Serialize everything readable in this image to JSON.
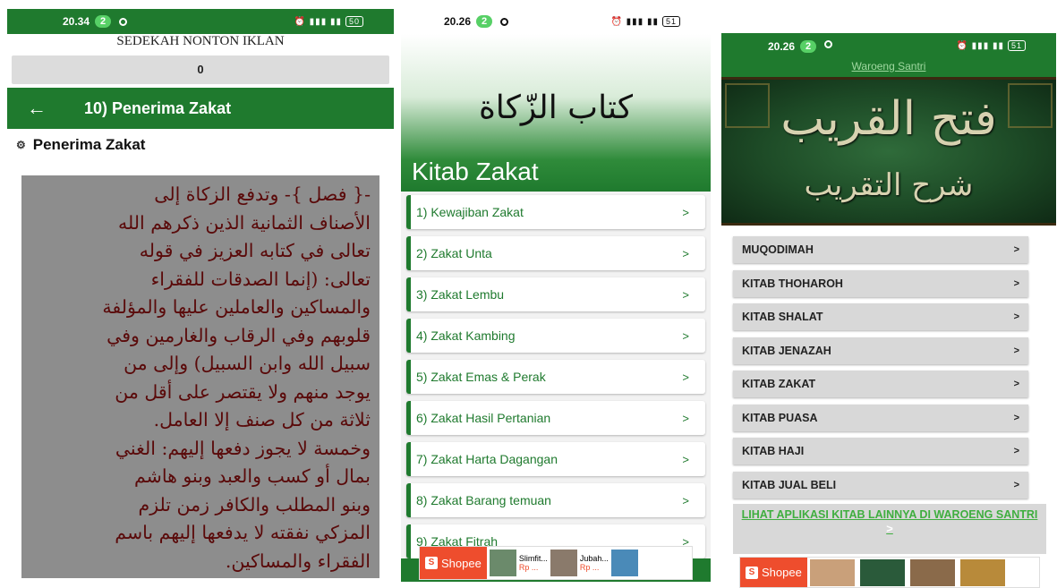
{
  "panel1": {
    "status": {
      "time": "20.34",
      "badge": "2",
      "battery": "50"
    },
    "sedekah_title": "SEDEKAH NONTON IKLAN",
    "counter_value": "0",
    "toolbar_title": "10) Penerima Zakat",
    "subheading": "Penerima Zakat",
    "arabic_lines": [
      "-{ فصل }- وتدفع الزكاة إلى",
      "الأصناف الثمانية الذين ذكرهم الله",
      "تعالى في كتابه العزيز في قوله",
      "تعالى: (إنما الصدقات للفقراء",
      "والمساكين والعاملين عليها والمؤلفة",
      "قلوبهم وفي الرقاب والغارمين وفي",
      "سبيل الله وابن السبيل) وإلى من",
      "يوجد منهم ولا يقتصر على أقل من",
      "ثلاثة من كل صنف إلا العامل.",
      "وخمسة لا يجوز دفعها إليهم: الغني",
      "بمال أو كسب والعبد وبنو هاشم",
      "وبنو المطلب والكافر زمن تلزم",
      "المزكي نفقته لا يدفعها إليهم باسم",
      "الفقراء والمساكين."
    ]
  },
  "panel2": {
    "status": {
      "time": "20.26",
      "badge": "2",
      "battery": "51"
    },
    "hero_arabic": "كتاب الزّكاة",
    "hero_title": "Kitab Zakat",
    "items": [
      "1) Kewajiban Zakat",
      "2) Zakat Unta",
      "3) Zakat Lembu",
      "4) Zakat Kambing",
      "5) Zakat Emas & Perak",
      "6) Zakat Hasil Pertanian",
      "7) Zakat Harta Dagangan",
      "8) Zakat Barang temuan",
      "9) Zakat Fitrah"
    ],
    "chevron": ">",
    "ad": {
      "brand": "Shopee",
      "item1": "Slimfit...",
      "item1_price": "Rp ...",
      "item2": "Jubah...",
      "item2_price": "Rp ..."
    }
  },
  "panel3": {
    "status": {
      "time": "20.26",
      "badge": "2",
      "battery": "51"
    },
    "link": "Waroeng Santri",
    "banner_title": "فتح القريب",
    "banner_subtitle": "شرح التقريب",
    "items": [
      "MUQODIMAH",
      "KITAB THOHAROH",
      "KITAB SHALAT",
      "KITAB JENAZAH",
      "KITAB ZAKAT",
      "KITAB PUASA",
      "KITAB HAJI",
      "KITAB JUAL BELI"
    ],
    "chevron": ">",
    "more_link": "LIHAT APLIKASI KITAB LAINNYA DI WAROENG SANTRI",
    "ad": {
      "brand": "Shopee"
    }
  },
  "colors": {
    "primary_green": "#1f7a2e",
    "arabic_text": "#5a0a0a",
    "shopee": "#ee4d2d"
  }
}
